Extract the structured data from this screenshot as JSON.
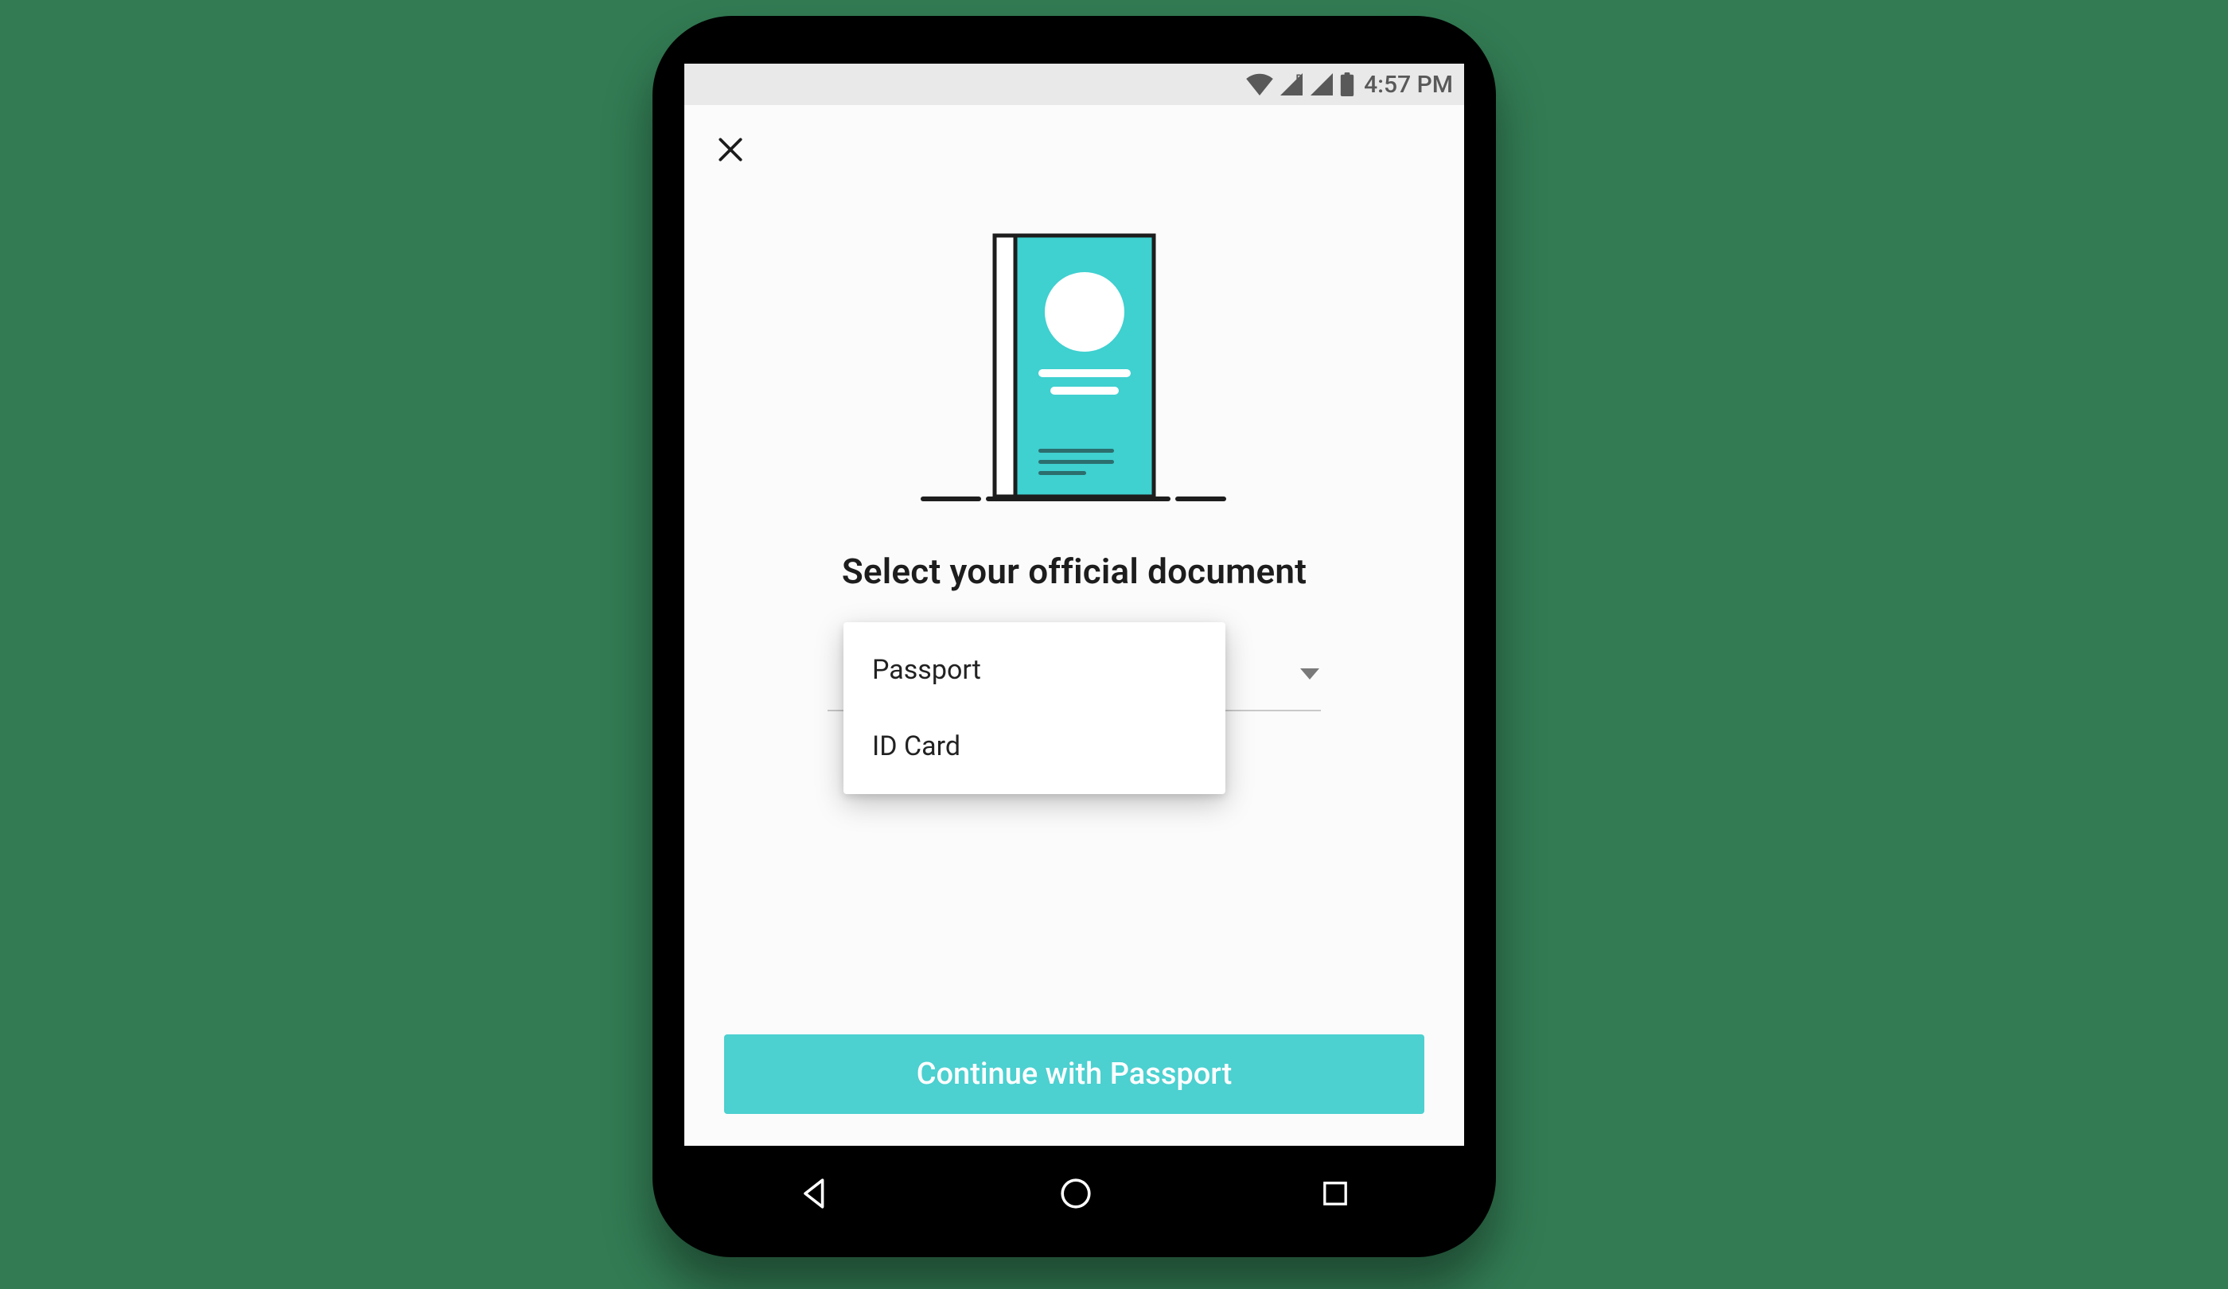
{
  "status_bar": {
    "time": "4:57 PM"
  },
  "screen": {
    "heading": "Select your official document",
    "menu": {
      "options": [
        "Passport",
        "ID Card"
      ]
    },
    "continue_label": "Continue with Passport"
  },
  "colors": {
    "accent": "#4cd0d0",
    "page_bg": "#327b53"
  }
}
